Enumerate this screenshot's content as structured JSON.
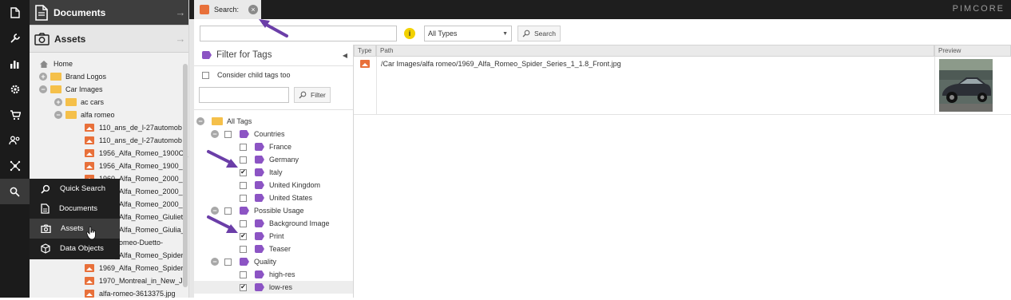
{
  "rail": {
    "icons": [
      "document-icon",
      "wrench-icon",
      "chart-icon",
      "gear-icon",
      "cart-icon",
      "users-icon",
      "network-icon",
      "search-icon"
    ]
  },
  "tree": {
    "documents_label": "Documents",
    "assets_label": "Assets",
    "nodes": [
      {
        "label": "Home",
        "depth": 0,
        "kind": "home"
      },
      {
        "label": "Brand Logos",
        "depth": 0,
        "kind": "folder",
        "exp": "+"
      },
      {
        "label": "Car Images",
        "depth": 0,
        "kind": "folder",
        "exp": "−"
      },
      {
        "label": "ac cars",
        "depth": 1,
        "kind": "folder",
        "exp": "+"
      },
      {
        "label": "alfa romeo",
        "depth": 1,
        "kind": "folder",
        "exp": "−"
      },
      {
        "label": "110_ans_de_l-27automob",
        "depth": 2,
        "kind": "image"
      },
      {
        "label": "110_ans_de_l-27automob",
        "depth": 2,
        "kind": "image"
      },
      {
        "label": "1956_Alfa_Romeo_1900C_",
        "depth": 2,
        "kind": "image"
      },
      {
        "label": "1956_Alfa_Romeo_1900_S",
        "depth": 2,
        "kind": "image"
      },
      {
        "label": "1960_Alfa_Romeo_2000_E",
        "depth": 2,
        "kind": "image"
      },
      {
        "label": "1960_Alfa_Romeo_2000_E",
        "depth": 2,
        "kind": "image"
      },
      {
        "label": "1960_Alfa_Romeo_2000_E",
        "depth": 2,
        "kind": "image"
      },
      {
        "label": "1960_Alfa_Romeo_Giuliet",
        "depth": 2,
        "kind": "image"
      },
      {
        "label": "1960_Alfa_Romeo_Giulia_",
        "depth": 2,
        "kind": "image"
      },
      {
        "label": "Alfa-Romeo-Duetto-",
        "depth": 2,
        "kind": "image"
      },
      {
        "label": "1969_Alfa_Romeo_Spider",
        "depth": 2,
        "kind": "image"
      },
      {
        "label": "1969_Alfa_Romeo_Spider",
        "depth": 2,
        "kind": "image"
      },
      {
        "label": "1970_Montreal_in_New_Je",
        "depth": 2,
        "kind": "image"
      },
      {
        "label": "alfa-romeo-3613375.jpg",
        "depth": 2,
        "kind": "image"
      }
    ]
  },
  "popup": {
    "items": [
      {
        "label": "Quick Search",
        "icon": "search-icon"
      },
      {
        "label": "Documents",
        "icon": "document-icon"
      },
      {
        "label": "Assets",
        "icon": "camera-icon"
      },
      {
        "label": "Data Objects",
        "icon": "cube-icon"
      }
    ]
  },
  "tab": {
    "label": "Search:"
  },
  "logo": "PIMCORE",
  "toolbar": {
    "search_value": "",
    "type_select": "All Types",
    "search_btn": "Search"
  },
  "filter": {
    "title": "Filter for Tags",
    "child_tags": "Consider child tags too",
    "filter_input": "",
    "filter_btn": "Filter",
    "rows": [
      {
        "label": "All Tags",
        "depth": 0,
        "kind": "root",
        "exp": "−",
        "cb": false
      },
      {
        "label": "Countries",
        "depth": 1,
        "kind": "tag",
        "exp": "−",
        "cb": true,
        "checked": false
      },
      {
        "label": "France",
        "depth": 2,
        "kind": "tag",
        "cb": true,
        "checked": false
      },
      {
        "label": "Germany",
        "depth": 2,
        "kind": "tag",
        "cb": true,
        "checked": false
      },
      {
        "label": "Italy",
        "depth": 2,
        "kind": "tag",
        "cb": true,
        "checked": true
      },
      {
        "label": "United Kingdom",
        "depth": 2,
        "kind": "tag",
        "cb": true,
        "checked": false
      },
      {
        "label": "United States",
        "depth": 2,
        "kind": "tag",
        "cb": true,
        "checked": false
      },
      {
        "label": "Possible Usage",
        "depth": 1,
        "kind": "tag",
        "exp": "−",
        "cb": true,
        "checked": false
      },
      {
        "label": "Background Image",
        "depth": 2,
        "kind": "tag",
        "cb": true,
        "checked": false
      },
      {
        "label": "Print",
        "depth": 2,
        "kind": "tag",
        "cb": true,
        "checked": true
      },
      {
        "label": "Teaser",
        "depth": 2,
        "kind": "tag",
        "cb": true,
        "checked": false
      },
      {
        "label": "Quality",
        "depth": 1,
        "kind": "tag",
        "exp": "−",
        "cb": true,
        "checked": false
      },
      {
        "label": "high-res",
        "depth": 2,
        "kind": "tag",
        "cb": true,
        "checked": false
      },
      {
        "label": "low-res",
        "depth": 2,
        "kind": "tag",
        "cb": true,
        "checked": true
      }
    ]
  },
  "grid": {
    "headers": {
      "type": "Type",
      "path": "Path",
      "preview": "Preview"
    },
    "rows": [
      {
        "path": "/Car Images/alfa romeo/1969_Alfa_Romeo_Spider_Series_1_1.8_Front.jpg"
      }
    ]
  },
  "colors": {
    "accent_purple": "#8c54c4",
    "asset_orange": "#e8703a",
    "folder_yellow": "#f5c04a",
    "arrow_purple": "#6b3ea8"
  }
}
